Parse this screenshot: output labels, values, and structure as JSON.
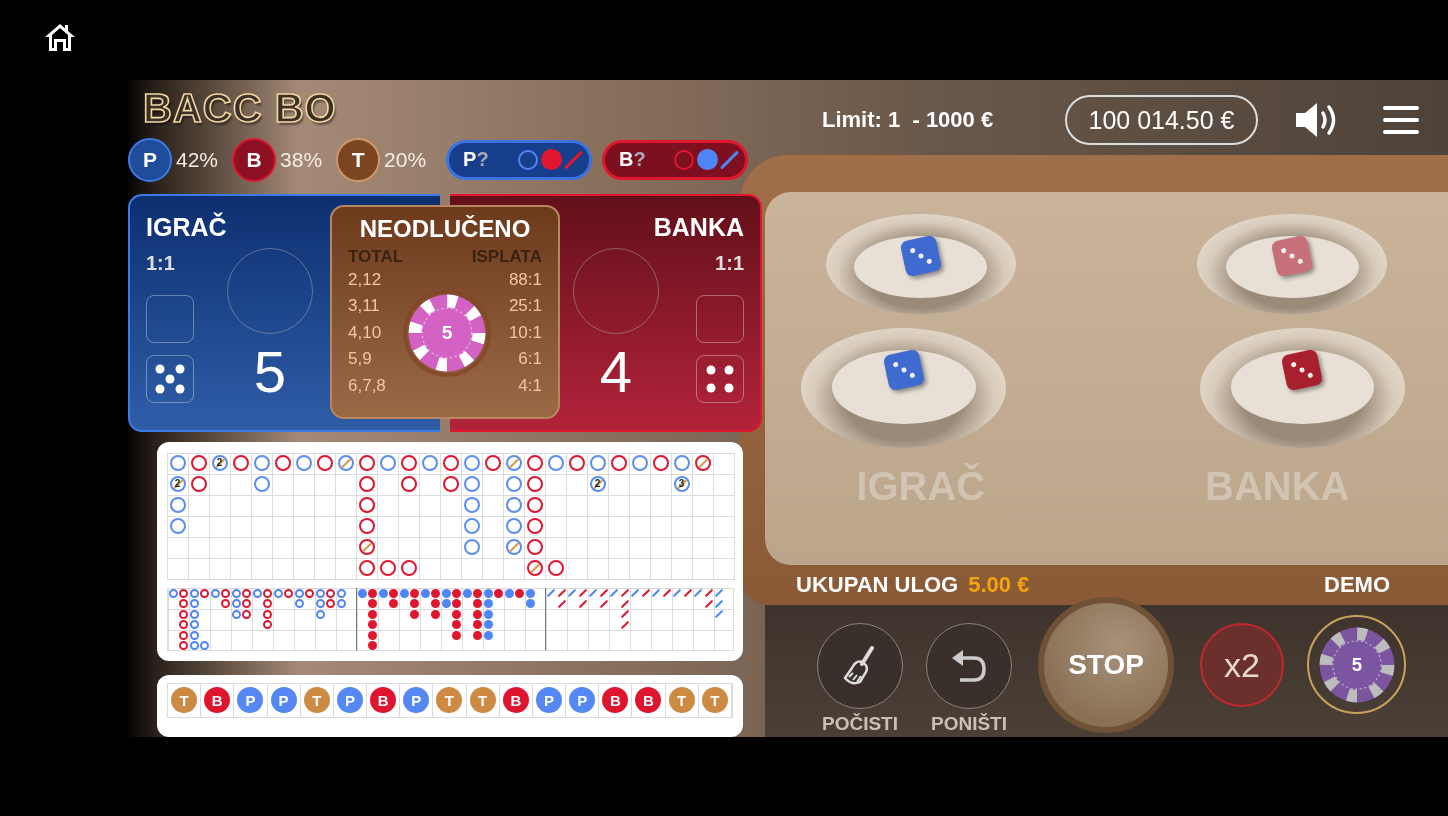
{
  "logo": "BACC BO",
  "limit": "Limit: 1  - 1000 €",
  "balance": "100 014.50 €",
  "stats": [
    {
      "kind": "player",
      "letter": "P",
      "percent": "42%"
    },
    {
      "kind": "banker",
      "letter": "B",
      "percent": "38%"
    },
    {
      "kind": "tie",
      "letter": "T",
      "percent": "20%"
    }
  ],
  "predictions": [
    {
      "kind": "player",
      "label": "P",
      "mark": "?",
      "marks": [
        {
          "kind": "hollow",
          "color": "#4f86f7"
        },
        {
          "kind": "filled",
          "color": "#e0162f"
        },
        {
          "kind": "slash",
          "color": "#e0162f"
        }
      ]
    },
    {
      "kind": "banker",
      "label": "B",
      "mark": "?",
      "marks": [
        {
          "kind": "hollow",
          "color": "#e0162f"
        },
        {
          "kind": "filled",
          "color": "#4f86f7"
        },
        {
          "kind": "slash",
          "color": "#4f86f7"
        }
      ]
    }
  ],
  "panels": [
    {
      "kind": "player",
      "title": "IGRAČ",
      "odds": "1:1",
      "score": "5",
      "die": {
        "kind": "five"
      }
    },
    {
      "kind": "banker",
      "title": "BANKA",
      "odds": "1:1",
      "score": "4",
      "die": {
        "kind": "four"
      }
    }
  ],
  "tie_panel": {
    "title": "NEODLUČENO",
    "headers": [
      "TOTAL",
      "ISPLATA"
    ],
    "rows": [
      {
        "total": "2,12",
        "payout": "88:1"
      },
      {
        "total": "3,11",
        "payout": "25:1"
      },
      {
        "total": "4,10",
        "payout": "10:1"
      },
      {
        "total": "5,9",
        "payout": "6:1"
      },
      {
        "total": "6,7,8",
        "payout": "4:1"
      }
    ],
    "chip": {
      "value": "5",
      "color": "#d461c4"
    }
  },
  "big_road": {
    "rows": [
      [
        {
          "kind": "player",
          "tie": false
        },
        {
          "kind": "banker",
          "tie": false
        },
        {
          "kind": "player",
          "tie": true,
          "tie_count": "2"
        },
        {
          "kind": "banker",
          "tie": false
        },
        {
          "kind": "player",
          "tie": false
        },
        {
          "kind": "banker",
          "tie": false
        },
        {
          "kind": "player",
          "tie": false
        },
        {
          "kind": "banker",
          "tie": false
        },
        {
          "kind": "player",
          "tie": true
        },
        {
          "kind": "banker",
          "tie": false
        },
        {
          "kind": "player",
          "tie": false
        },
        {
          "kind": "banker",
          "tie": false
        },
        {
          "kind": "player",
          "tie": false
        },
        {
          "kind": "banker",
          "tie": false
        },
        {
          "kind": "player",
          "tie": false
        },
        {
          "kind": "banker",
          "tie": false
        },
        {
          "kind": "player",
          "tie": true
        },
        {
          "kind": "banker",
          "tie": false
        },
        {
          "kind": "player",
          "tie": false
        },
        {
          "kind": "banker",
          "tie": false
        },
        {
          "kind": "player",
          "tie": false
        },
        {
          "kind": "banker",
          "tie": false
        },
        {
          "kind": "player",
          "tie": false
        },
        {
          "kind": "banker",
          "tie": false
        },
        {
          "kind": "player",
          "tie": false
        },
        {
          "kind": "banker",
          "tie": true
        }
      ],
      [
        {
          "kind": "player",
          "tie": true,
          "tie_count": "2"
        },
        {
          "kind": "banker",
          "tie": false
        },
        {
          "kind": "empty"
        },
        {
          "kind": "empty"
        },
        {
          "kind": "player",
          "tie": false
        },
        {
          "kind": "empty"
        },
        {
          "kind": "empty"
        },
        {
          "kind": "empty"
        },
        {
          "kind": "empty"
        },
        {
          "kind": "banker",
          "tie": false
        },
        {
          "kind": "empty"
        },
        {
          "kind": "banker",
          "tie": false
        },
        {
          "kind": "empty"
        },
        {
          "kind": "banker",
          "tie": false
        },
        {
          "kind": "player",
          "tie": false
        },
        {
          "kind": "empty"
        },
        {
          "kind": "player",
          "tie": false
        },
        {
          "kind": "banker",
          "tie": false
        },
        {
          "kind": "empty"
        },
        {
          "kind": "empty"
        },
        {
          "kind": "player",
          "tie": true,
          "tie_count": "2"
        },
        {
          "kind": "empty"
        },
        {
          "kind": "empty"
        },
        {
          "kind": "empty"
        },
        {
          "kind": "player",
          "tie": true,
          "tie_count": "3"
        }
      ],
      [
        {
          "kind": "player",
          "tie": false
        },
        {
          "kind": "empty"
        },
        {
          "kind": "empty"
        },
        {
          "kind": "empty"
        },
        {
          "kind": "empty"
        },
        {
          "kind": "empty"
        },
        {
          "kind": "empty"
        },
        {
          "kind": "empty"
        },
        {
          "kind": "empty"
        },
        {
          "kind": "banker",
          "tie": false
        },
        {
          "kind": "empty"
        },
        {
          "kind": "empty"
        },
        {
          "kind": "empty"
        },
        {
          "kind": "empty"
        },
        {
          "kind": "player",
          "tie": false
        },
        {
          "kind": "empty"
        },
        {
          "kind": "player",
          "tie": false
        },
        {
          "kind": "banker",
          "tie": false
        }
      ],
      [
        {
          "kind": "player",
          "tie": false
        },
        {
          "kind": "empty"
        },
        {
          "kind": "empty"
        },
        {
          "kind": "empty"
        },
        {
          "kind": "empty"
        },
        {
          "kind": "empty"
        },
        {
          "kind": "empty"
        },
        {
          "kind": "empty"
        },
        {
          "kind": "empty"
        },
        {
          "kind": "banker",
          "tie": false
        },
        {
          "kind": "empty"
        },
        {
          "kind": "empty"
        },
        {
          "kind": "empty"
        },
        {
          "kind": "empty"
        },
        {
          "kind": "player",
          "tie": false
        },
        {
          "kind": "empty"
        },
        {
          "kind": "player",
          "tie": false
        },
        {
          "kind": "banker",
          "tie": false
        }
      ],
      [
        {
          "kind": "empty"
        },
        {
          "kind": "empty"
        },
        {
          "kind": "empty"
        },
        {
          "kind": "empty"
        },
        {
          "kind": "empty"
        },
        {
          "kind": "empty"
        },
        {
          "kind": "empty"
        },
        {
          "kind": "empty"
        },
        {
          "kind": "empty"
        },
        {
          "kind": "banker",
          "tie": true
        },
        {
          "kind": "empty"
        },
        {
          "kind": "empty"
        },
        {
          "kind": "empty"
        },
        {
          "kind": "empty"
        },
        {
          "kind": "player",
          "tie": false
        },
        {
          "kind": "empty"
        },
        {
          "kind": "player",
          "tie": true
        },
        {
          "kind": "banker",
          "tie": false
        }
      ],
      [
        {
          "kind": "empty"
        },
        {
          "kind": "empty"
        },
        {
          "kind": "empty"
        },
        {
          "kind": "empty"
        },
        {
          "kind": "empty"
        },
        {
          "kind": "empty"
        },
        {
          "kind": "empty"
        },
        {
          "kind": "empty"
        },
        {
          "kind": "empty"
        },
        {
          "kind": "banker",
          "tie": false
        },
        {
          "kind": "banker",
          "tie": false
        },
        {
          "kind": "banker",
          "tie": false
        },
        {
          "kind": "empty"
        },
        {
          "kind": "empty"
        },
        {
          "kind": "empty"
        },
        {
          "kind": "empty"
        },
        {
          "kind": "empty"
        },
        {
          "kind": "banker",
          "tie": true
        },
        {
          "kind": "banker",
          "tie": false
        }
      ]
    ]
  },
  "derived_roads": [
    {
      "kind": "hollow",
      "rows": [
        [
          {
            "kind": "mark",
            "color": "#4f86f7"
          },
          {
            "kind": "mark",
            "color": "#e0162f"
          },
          {
            "kind": "mark",
            "color": "#4f86f7"
          },
          {
            "kind": "mark",
            "color": "#e0162f"
          },
          {
            "kind": "mark",
            "color": "#4f86f7"
          },
          {
            "kind": "mark",
            "color": "#e0162f"
          },
          {
            "kind": "mark",
            "color": "#4f86f7"
          },
          {
            "kind": "mark",
            "color": "#e0162f"
          },
          {
            "kind": "mark",
            "color": "#4f86f7"
          },
          {
            "kind": "mark",
            "color": "#e0162f"
          },
          {
            "kind": "mark",
            "color": "#4f86f7"
          },
          {
            "kind": "mark",
            "color": "#e0162f"
          },
          {
            "kind": "mark",
            "color": "#4f86f7"
          },
          {
            "kind": "mark",
            "color": "#e0162f"
          },
          {
            "kind": "mark",
            "color": "#4f86f7"
          },
          {
            "kind": "mark",
            "color": "#e0162f"
          },
          {
            "kind": "mark",
            "color": "#4f86f7"
          }
        ],
        [
          {
            "kind": "empty"
          },
          {
            "kind": "mark",
            "color": "#e0162f"
          },
          {
            "kind": "mark",
            "color": "#4f86f7"
          },
          {
            "kind": "empty"
          },
          {
            "kind": "empty"
          },
          {
            "kind": "mark",
            "color": "#e0162f"
          },
          {
            "kind": "mark",
            "color": "#4f86f7"
          },
          {
            "kind": "mark",
            "color": "#e0162f"
          },
          {
            "kind": "empty"
          },
          {
            "kind": "mark",
            "color": "#e0162f"
          },
          {
            "kind": "empty"
          },
          {
            "kind": "empty"
          },
          {
            "kind": "mark",
            "color": "#4f86f7"
          },
          {
            "kind": "empty"
          },
          {
            "kind": "mark",
            "color": "#4f86f7"
          },
          {
            "kind": "mark",
            "color": "#e0162f"
          },
          {
            "kind": "mark",
            "color": "#4f86f7"
          }
        ],
        [
          {
            "kind": "empty"
          },
          {
            "kind": "mark",
            "color": "#e0162f"
          },
          {
            "kind": "mark",
            "color": "#4f86f7"
          },
          {
            "kind": "empty"
          },
          {
            "kind": "empty"
          },
          {
            "kind": "empty"
          },
          {
            "kind": "mark",
            "color": "#4f86f7"
          },
          {
            "kind": "mark",
            "color": "#e0162f"
          },
          {
            "kind": "empty"
          },
          {
            "kind": "mark",
            "color": "#e0162f"
          },
          {
            "kind": "empty"
          },
          {
            "kind": "empty"
          },
          {
            "kind": "empty"
          },
          {
            "kind": "empty"
          },
          {
            "kind": "mark",
            "color": "#4f86f7"
          }
        ],
        [
          {
            "kind": "empty"
          },
          {
            "kind": "mark",
            "color": "#e0162f"
          },
          {
            "kind": "mark",
            "color": "#4f86f7"
          },
          {
            "kind": "empty"
          },
          {
            "kind": "empty"
          },
          {
            "kind": "empty"
          },
          {
            "kind": "empty"
          },
          {
            "kind": "empty"
          },
          {
            "kind": "empty"
          },
          {
            "kind": "mark",
            "color": "#e0162f"
          }
        ],
        [
          {
            "kind": "empty"
          },
          {
            "kind": "mark",
            "color": "#e0162f"
          },
          {
            "kind": "mark",
            "color": "#4f86f7"
          }
        ],
        [
          {
            "kind": "empty"
          },
          {
            "kind": "mark",
            "color": "#e0162f"
          },
          {
            "kind": "mark",
            "color": "#4f86f7"
          },
          {
            "kind": "mark",
            "color": "#4f86f7"
          }
        ]
      ]
    },
    {
      "kind": "filled",
      "rows": [
        [
          {
            "kind": "mark",
            "color": "#4f86f7"
          },
          {
            "kind": "mark",
            "color": "#e0162f"
          },
          {
            "kind": "mark",
            "color": "#4f86f7"
          },
          {
            "kind": "mark",
            "color": "#e0162f"
          },
          {
            "kind": "mark",
            "color": "#4f86f7"
          },
          {
            "kind": "mark",
            "color": "#e0162f"
          },
          {
            "kind": "mark",
            "color": "#4f86f7"
          },
          {
            "kind": "mark",
            "color": "#e0162f"
          },
          {
            "kind": "mark",
            "color": "#4f86f7"
          },
          {
            "kind": "mark",
            "color": "#e0162f"
          },
          {
            "kind": "mark",
            "color": "#4f86f7"
          },
          {
            "kind": "mark",
            "color": "#e0162f"
          },
          {
            "kind": "mark",
            "color": "#4f86f7"
          },
          {
            "kind": "mark",
            "color": "#e0162f"
          },
          {
            "kind": "mark",
            "color": "#4f86f7"
          },
          {
            "kind": "mark",
            "color": "#e0162f"
          },
          {
            "kind": "mark",
            "color": "#4f86f7"
          }
        ],
        [
          {
            "kind": "empty"
          },
          {
            "kind": "mark",
            "color": "#e0162f"
          },
          {
            "kind": "empty"
          },
          {
            "kind": "mark",
            "color": "#e0162f"
          },
          {
            "kind": "empty"
          },
          {
            "kind": "mark",
            "color": "#e0162f"
          },
          {
            "kind": "empty"
          },
          {
            "kind": "mark",
            "color": "#e0162f"
          },
          {
            "kind": "mark",
            "color": "#4f86f7"
          },
          {
            "kind": "mark",
            "color": "#e0162f"
          },
          {
            "kind": "empty"
          },
          {
            "kind": "mark",
            "color": "#e0162f"
          },
          {
            "kind": "mark",
            "color": "#4f86f7"
          },
          {
            "kind": "empty"
          },
          {
            "kind": "empty"
          },
          {
            "kind": "empty"
          },
          {
            "kind": "mark",
            "color": "#4f86f7"
          }
        ],
        [
          {
            "kind": "empty"
          },
          {
            "kind": "mark",
            "color": "#e0162f"
          },
          {
            "kind": "empty"
          },
          {
            "kind": "empty"
          },
          {
            "kind": "empty"
          },
          {
            "kind": "mark",
            "color": "#e0162f"
          },
          {
            "kind": "empty"
          },
          {
            "kind": "mark",
            "color": "#e0162f"
          },
          {
            "kind": "empty"
          },
          {
            "kind": "mark",
            "color": "#e0162f"
          },
          {
            "kind": "empty"
          },
          {
            "kind": "mark",
            "color": "#e0162f"
          },
          {
            "kind": "mark",
            "color": "#4f86f7"
          }
        ],
        [
          {
            "kind": "empty"
          },
          {
            "kind": "mark",
            "color": "#e0162f"
          },
          {
            "kind": "empty"
          },
          {
            "kind": "empty"
          },
          {
            "kind": "empty"
          },
          {
            "kind": "empty"
          },
          {
            "kind": "empty"
          },
          {
            "kind": "empty"
          },
          {
            "kind": "empty"
          },
          {
            "kind": "mark",
            "color": "#e0162f"
          },
          {
            "kind": "empty"
          },
          {
            "kind": "mark",
            "color": "#e0162f"
          },
          {
            "kind": "mark",
            "color": "#4f86f7"
          }
        ],
        [
          {
            "kind": "empty"
          },
          {
            "kind": "mark",
            "color": "#e0162f"
          },
          {
            "kind": "empty"
          },
          {
            "kind": "empty"
          },
          {
            "kind": "empty"
          },
          {
            "kind": "empty"
          },
          {
            "kind": "empty"
          },
          {
            "kind": "empty"
          },
          {
            "kind": "empty"
          },
          {
            "kind": "mark",
            "color": "#e0162f"
          },
          {
            "kind": "empty"
          },
          {
            "kind": "mark",
            "color": "#e0162f"
          },
          {
            "kind": "mark",
            "color": "#4f86f7"
          }
        ],
        [
          {
            "kind": "empty"
          },
          {
            "kind": "mark",
            "color": "#e0162f"
          }
        ]
      ]
    },
    {
      "kind": "slash",
      "rows": [
        [
          {
            "kind": "mark",
            "color": "#4f86f7"
          },
          {
            "kind": "mark",
            "color": "#e0162f"
          },
          {
            "kind": "mark",
            "color": "#4f86f7"
          },
          {
            "kind": "mark",
            "color": "#e0162f"
          },
          {
            "kind": "mark",
            "color": "#4f86f7"
          },
          {
            "kind": "mark",
            "color": "#e0162f"
          },
          {
            "kind": "mark",
            "color": "#4f86f7"
          },
          {
            "kind": "mark",
            "color": "#e0162f"
          },
          {
            "kind": "mark",
            "color": "#4f86f7"
          },
          {
            "kind": "mark",
            "color": "#e0162f"
          },
          {
            "kind": "mark",
            "color": "#4f86f7"
          },
          {
            "kind": "mark",
            "color": "#e0162f"
          },
          {
            "kind": "mark",
            "color": "#4f86f7"
          },
          {
            "kind": "mark",
            "color": "#e0162f"
          },
          {
            "kind": "mark",
            "color": "#4f86f7"
          },
          {
            "kind": "mark",
            "color": "#e0162f"
          },
          {
            "kind": "mark",
            "color": "#4f86f7"
          }
        ],
        [
          {
            "kind": "empty"
          },
          {
            "kind": "mark",
            "color": "#e0162f"
          },
          {
            "kind": "empty"
          },
          {
            "kind": "mark",
            "color": "#e0162f"
          },
          {
            "kind": "empty"
          },
          {
            "kind": "mark",
            "color": "#e0162f"
          },
          {
            "kind": "empty"
          },
          {
            "kind": "mark",
            "color": "#e0162f"
          },
          {
            "kind": "empty"
          },
          {
            "kind": "empty"
          },
          {
            "kind": "empty"
          },
          {
            "kind": "empty"
          },
          {
            "kind": "empty"
          },
          {
            "kind": "empty"
          },
          {
            "kind": "empty"
          },
          {
            "kind": "mark",
            "color": "#e0162f"
          },
          {
            "kind": "mark",
            "color": "#4f86f7"
          }
        ],
        [
          {
            "kind": "empty"
          },
          {
            "kind": "empty"
          },
          {
            "kind": "empty"
          },
          {
            "kind": "empty"
          },
          {
            "kind": "empty"
          },
          {
            "kind": "empty"
          },
          {
            "kind": "empty"
          },
          {
            "kind": "mark",
            "color": "#e0162f"
          },
          {
            "kind": "empty"
          },
          {
            "kind": "empty"
          },
          {
            "kind": "empty"
          },
          {
            "kind": "empty"
          },
          {
            "kind": "empty"
          },
          {
            "kind": "empty"
          },
          {
            "kind": "empty"
          },
          {
            "kind": "empty"
          },
          {
            "kind": "mark",
            "color": "#4f86f7"
          }
        ],
        [
          {
            "kind": "empty"
          },
          {
            "kind": "empty"
          },
          {
            "kind": "empty"
          },
          {
            "kind": "empty"
          },
          {
            "kind": "empty"
          },
          {
            "kind": "empty"
          },
          {
            "kind": "empty"
          },
          {
            "kind": "mark",
            "color": "#e0162f"
          }
        ]
      ]
    }
  ],
  "bead_road": [
    {
      "kind": "tie",
      "letter": "T"
    },
    {
      "kind": "banker",
      "letter": "B"
    },
    {
      "kind": "player",
      "letter": "P"
    },
    {
      "kind": "player",
      "letter": "P"
    },
    {
      "kind": "tie",
      "letter": "T"
    },
    {
      "kind": "player",
      "letter": "P"
    },
    {
      "kind": "banker",
      "letter": "B"
    },
    {
      "kind": "player",
      "letter": "P"
    },
    {
      "kind": "tie",
      "letter": "T"
    },
    {
      "kind": "tie",
      "letter": "T"
    },
    {
      "kind": "banker",
      "letter": "B"
    },
    {
      "kind": "player",
      "letter": "P"
    },
    {
      "kind": "player",
      "letter": "P"
    },
    {
      "kind": "banker",
      "letter": "B"
    },
    {
      "kind": "banker",
      "letter": "B"
    },
    {
      "kind": "tie",
      "letter": "T"
    },
    {
      "kind": "tie",
      "letter": "T"
    }
  ],
  "dice_table": {
    "cups": [
      {
        "color": "#3f6bd0"
      },
      {
        "color": "#c8707a"
      },
      {
        "color": "#3f6bd0"
      },
      {
        "color": "#a8202e"
      }
    ],
    "labels": [
      "IGRAČ",
      "BANKA"
    ]
  },
  "total_bet": {
    "label": "UKUPAN ULOG",
    "amount": "5.00 €",
    "mode": "DEMO"
  },
  "actions": [
    {
      "kind": "clear",
      "label": "POČISTI"
    },
    {
      "kind": "undo",
      "label": "PONIŠTI"
    }
  ],
  "stop": "STOP",
  "double": "x2",
  "chip": {
    "value": "5",
    "color": "#7b559f",
    "selected": true
  }
}
